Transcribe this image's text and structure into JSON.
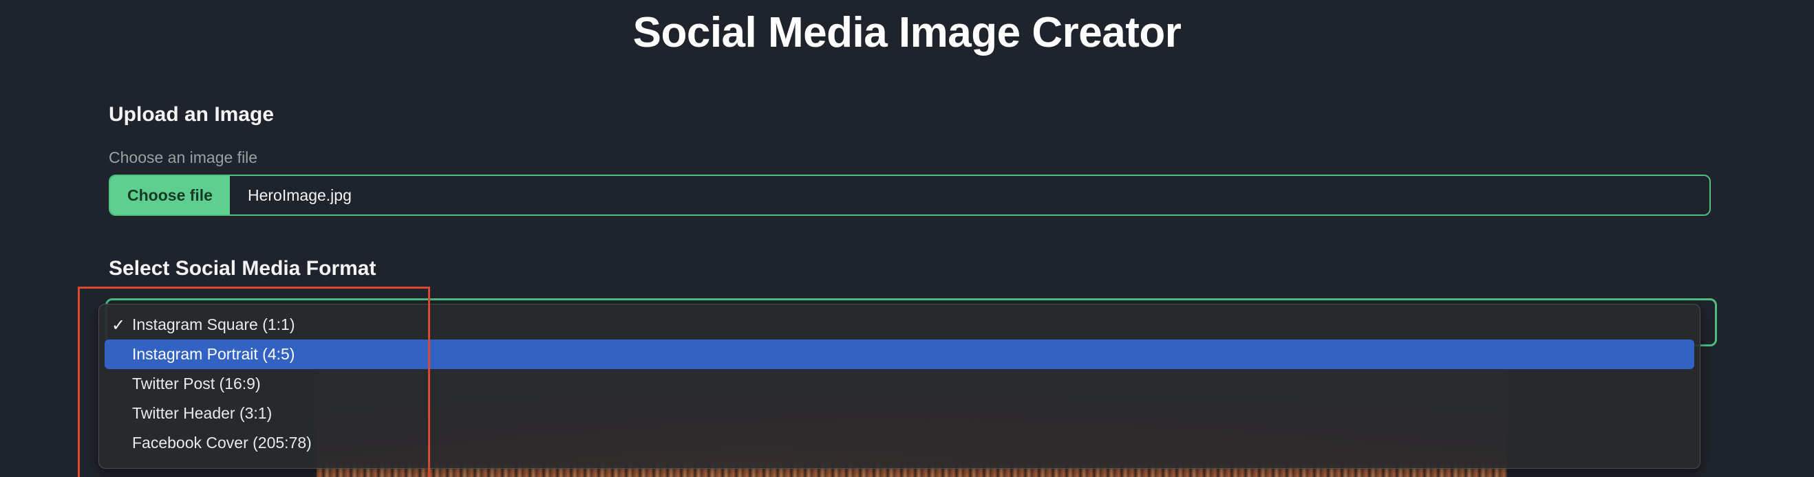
{
  "page": {
    "title": "Social Media Image Creator"
  },
  "upload": {
    "heading": "Upload an Image",
    "label": "Choose an image file",
    "button_label": "Choose file",
    "file_name": "HeroImage.jpg"
  },
  "format": {
    "heading": "Select Social Media Format",
    "selected": "Instagram Square (1:1)",
    "highlighted": "Instagram Portrait (4:5)",
    "options": [
      {
        "label": "Instagram Square (1:1)",
        "checked": true
      },
      {
        "label": "Instagram Portrait (4:5)",
        "checked": false
      },
      {
        "label": "Twitter Post (16:9)",
        "checked": false
      },
      {
        "label": "Twitter Header (3:1)",
        "checked": false
      },
      {
        "label": "Facebook Cover (205:78)",
        "checked": false
      }
    ],
    "check_glyph": "✓"
  },
  "colors": {
    "background": "#1f232b",
    "accent": "#5ecf8f",
    "highlight": "#3162c4",
    "annotation": "#d94a33"
  },
  "icons": {
    "check": "checkmark-icon"
  }
}
